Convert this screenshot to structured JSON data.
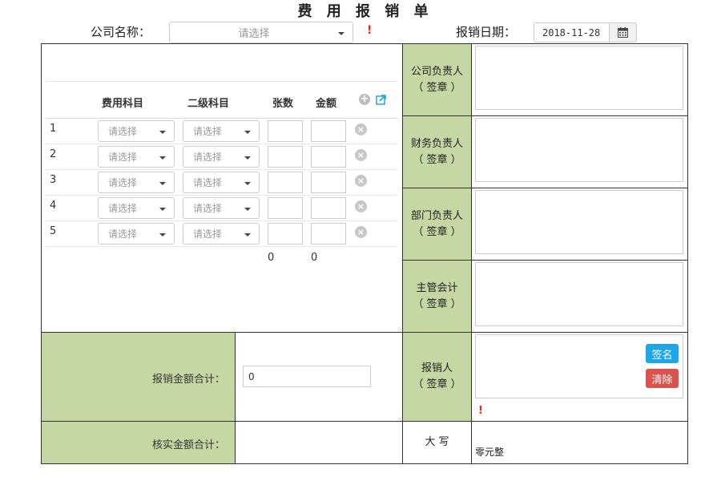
{
  "title": "费 用 报 销 单",
  "header": {
    "company_label": "公司名称：",
    "company_placeholder": "请选择",
    "company_required": "!",
    "date_label": "报销日期：",
    "date_value": "2018-11-28"
  },
  "table": {
    "columns": [
      "费用科目",
      "二级科目",
      "张数",
      "金额"
    ],
    "rows": [
      {
        "num": "1",
        "subject": "请选择",
        "subsubject": "请选择"
      },
      {
        "num": "2",
        "subject": "请选择",
        "subsubject": "请选择"
      },
      {
        "num": "3",
        "subject": "请选择",
        "subsubject": "请选择"
      },
      {
        "num": "4",
        "subject": "请选择",
        "subsubject": "请选择"
      },
      {
        "num": "5",
        "subject": "请选择",
        "subsubject": "请选择"
      }
    ],
    "total_count": "0",
    "total_amount": "0"
  },
  "signatures": [
    {
      "role": "公司负责人",
      "note": "（ 签章 ）"
    },
    {
      "role": "财务负责人",
      "note": "（ 签章 ）"
    },
    {
      "role": "部门负责人",
      "note": "（ 签章 ）"
    },
    {
      "role": "主管会计",
      "note": "（ 签章 ）"
    },
    {
      "role": "报销人",
      "note": "（ 签章 ）"
    }
  ],
  "claimant": {
    "sign_button": "签名",
    "clear_button": "清除",
    "required": "!"
  },
  "summary": {
    "claim_total_label": "报销金额合计：",
    "claim_total_value": "0",
    "verified_total_label": "核实金额合计：",
    "uppercase_label": "大 写",
    "uppercase_value": "零元整"
  },
  "colors": {
    "label_bg": "#c5d8a4",
    "sign_button": "#1ea7e6",
    "clear_button": "#d9534f",
    "required_mark": "#d9301e"
  },
  "icons": [
    "chevron-down-icon",
    "calendar-icon",
    "add-row-icon",
    "import-icon",
    "remove-row-icon"
  ]
}
